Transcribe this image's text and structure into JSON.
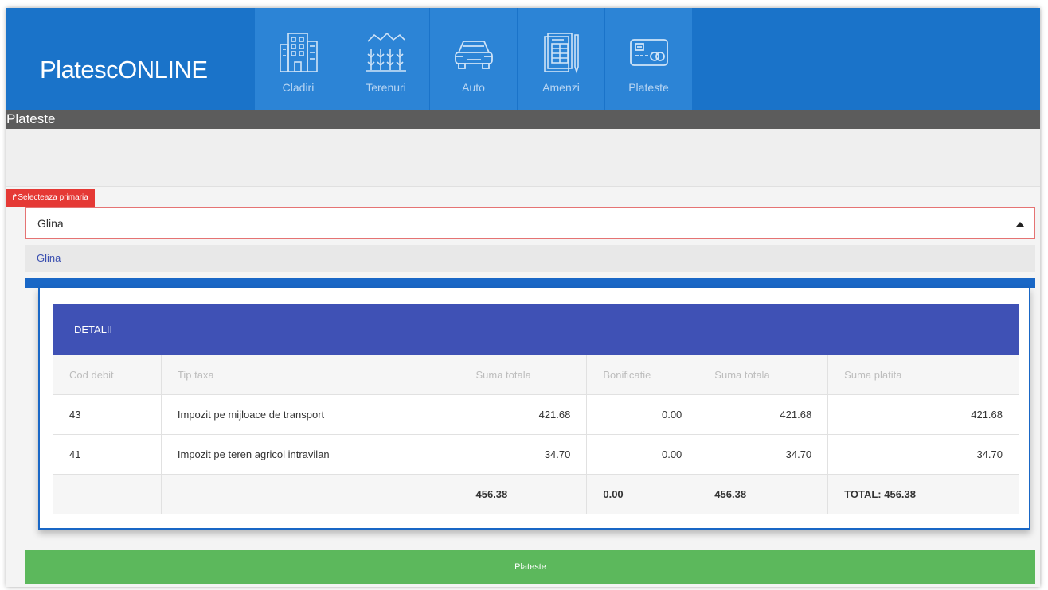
{
  "brand": "PlatescONLINE",
  "nav": [
    {
      "label": "Cladiri",
      "icon": "building-icon"
    },
    {
      "label": "Terenuri",
      "icon": "land-icon"
    },
    {
      "label": "Auto",
      "icon": "car-icon"
    },
    {
      "label": "Amenzi",
      "icon": "document-icon"
    },
    {
      "label": "Plateste",
      "icon": "credit-card-icon"
    }
  ],
  "page_title": "Plateste",
  "selector": {
    "tag_label": "Selecteaza primaria",
    "tag_icon": "share-arrow-icon",
    "value": "Glina",
    "options": [
      "Glina"
    ]
  },
  "details": {
    "title": "DETALII",
    "columns": [
      "Cod debit",
      "Tip taxa",
      "Suma totala",
      "Bonificatie",
      "Suma totala",
      "Suma platita"
    ],
    "rows": [
      [
        "43",
        "Impozit pe mijloace de transport",
        "421.68",
        "0.00",
        "421.68",
        "421.68"
      ],
      [
        "41",
        "Impozit pe teren agricol intravilan",
        "34.70",
        "0.00",
        "34.70",
        "34.70"
      ]
    ],
    "totals": [
      "",
      "",
      "456.38",
      "0.00",
      "456.38",
      "TOTAL: 456.38"
    ]
  },
  "pay_button": "Plateste",
  "colors": {
    "header": "#1a73c9",
    "nav_tile": "#2c84d6",
    "details_header": "#3f51b5",
    "pay_button": "#5cb85c",
    "tag": "#e53935"
  }
}
